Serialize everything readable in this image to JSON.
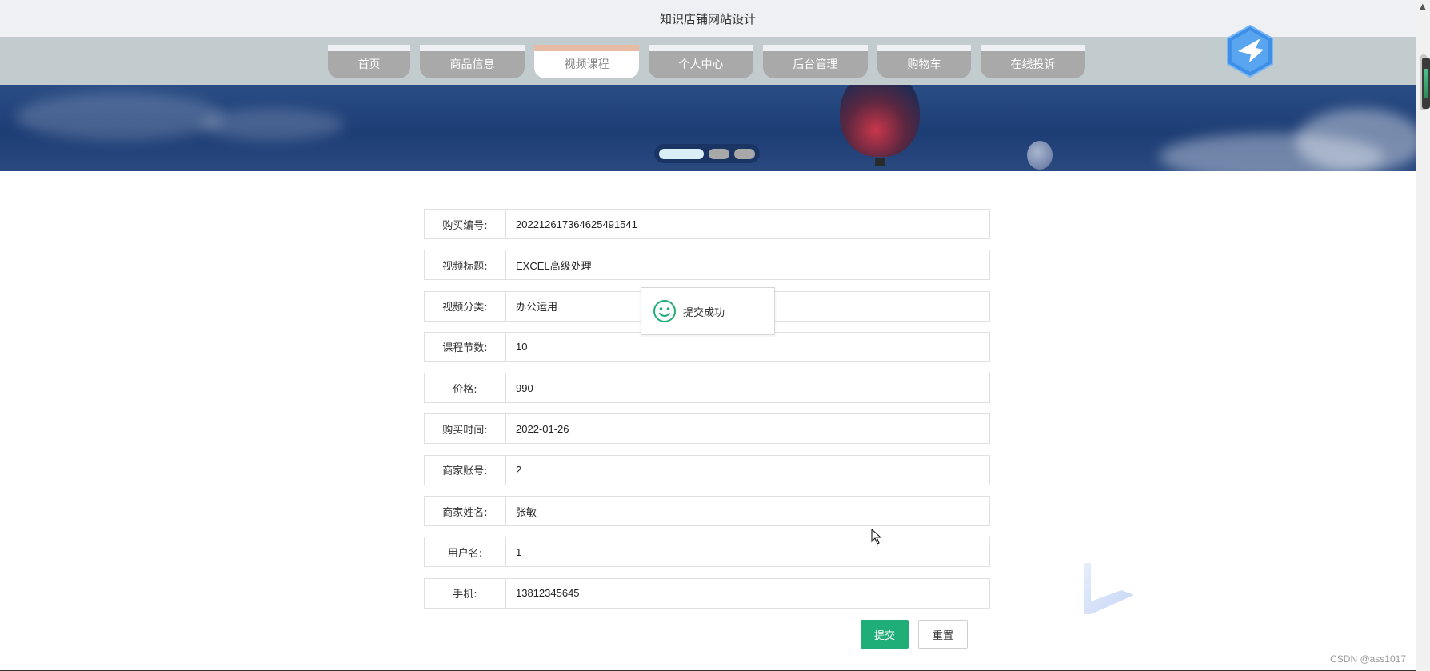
{
  "site": {
    "title": "知识店铺网站设计"
  },
  "nav": {
    "items": [
      {
        "label": "首页"
      },
      {
        "label": "商品信息"
      },
      {
        "label": "视频课程",
        "active": true
      },
      {
        "label": "个人中心"
      },
      {
        "label": "后台管理"
      },
      {
        "label": "购物车"
      },
      {
        "label": "在线投诉"
      }
    ]
  },
  "banner": {
    "slides_total": 3,
    "active_slide": 1
  },
  "form": {
    "fields": [
      {
        "label": "购买编号:",
        "value": "202212617364625491541"
      },
      {
        "label": "视频标题:",
        "value": "EXCEL高级处理"
      },
      {
        "label": "视频分类:",
        "value": "办公运用"
      },
      {
        "label": "课程节数:",
        "value": "10"
      },
      {
        "label": "价格:",
        "value": "990"
      },
      {
        "label": "购买时间:",
        "value": "2022-01-26"
      },
      {
        "label": "商家账号:",
        "value": "2"
      },
      {
        "label": "商家姓名:",
        "value": "张敏"
      },
      {
        "label": "用户名:",
        "value": "1"
      },
      {
        "label": "手机:",
        "value": "13812345645"
      }
    ],
    "submit_label": "提交",
    "reset_label": "重置"
  },
  "toast": {
    "message": "提交成功",
    "icon": "smile-icon"
  },
  "watermark": "CSDN @ass1017",
  "colors": {
    "topbar_bg": "#eef0f3",
    "nav_band_bg": "#c2cbcd",
    "nav_item_bg": "#a9a9a9",
    "nav_active_accent": "#e8bba4",
    "submit_bg": "#1fae78",
    "toast_icon": "#1fae78",
    "logo_blue": "#3d8fe8"
  }
}
